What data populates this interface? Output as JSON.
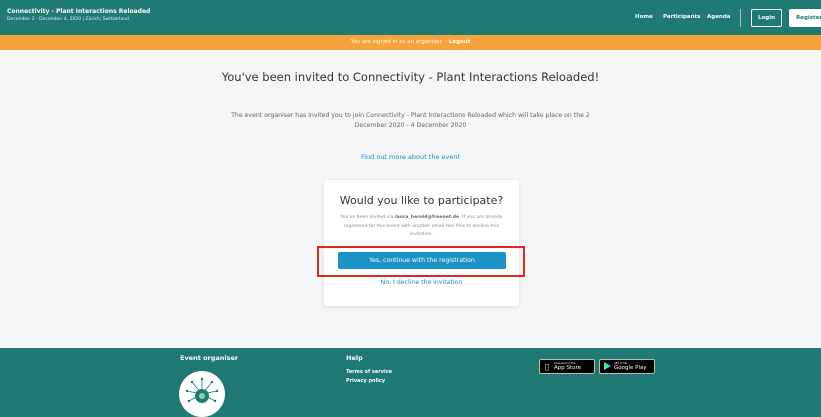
{
  "header": {
    "event_name": "Connectivity - Plant Interactions Reloaded",
    "event_meta": "December 2 - December 4, 2020 | Zürich, Switzerland",
    "nav": [
      "Home",
      "Participants",
      "Agenda"
    ],
    "login_label": "Login",
    "register_label": "Register",
    "colors": {
      "header_bg": "#1e7a72"
    }
  },
  "banner": {
    "text": "You are signed in as an organiser.",
    "logout_label": "Logout",
    "color": "#f7a23a"
  },
  "main": {
    "title": "You've been invited to Connectivity - Plant Interactions Reloaded!",
    "description": "The event organiser has invited you to join Connectivity - Plant Interactions Reloaded which will take place on the 2 December 2020 - 4 December 2020",
    "find_more_label": "Find out more about the event"
  },
  "card": {
    "title": "Would you like to participate?",
    "text_before": "You've been invited via ",
    "email": "laura_herold@freenet.de",
    "text_after": ". If you are already registered for this event with another email feel free to decline this invitation.",
    "yes_label": "Yes, continue with the registration",
    "no_label": "No, I decline the invitation",
    "accent_color": "#1c93c6"
  },
  "footer": {
    "organiser_heading": "Event organiser",
    "help_heading": "Help",
    "help_links": [
      "Terms of service",
      "Privacy policy"
    ],
    "app_store": {
      "small": "Download on the",
      "big": "App Store",
      "icon": "apple-icon"
    },
    "google_play": {
      "small": "GET IT ON",
      "big": "Google Play",
      "icon": "play-icon"
    }
  }
}
